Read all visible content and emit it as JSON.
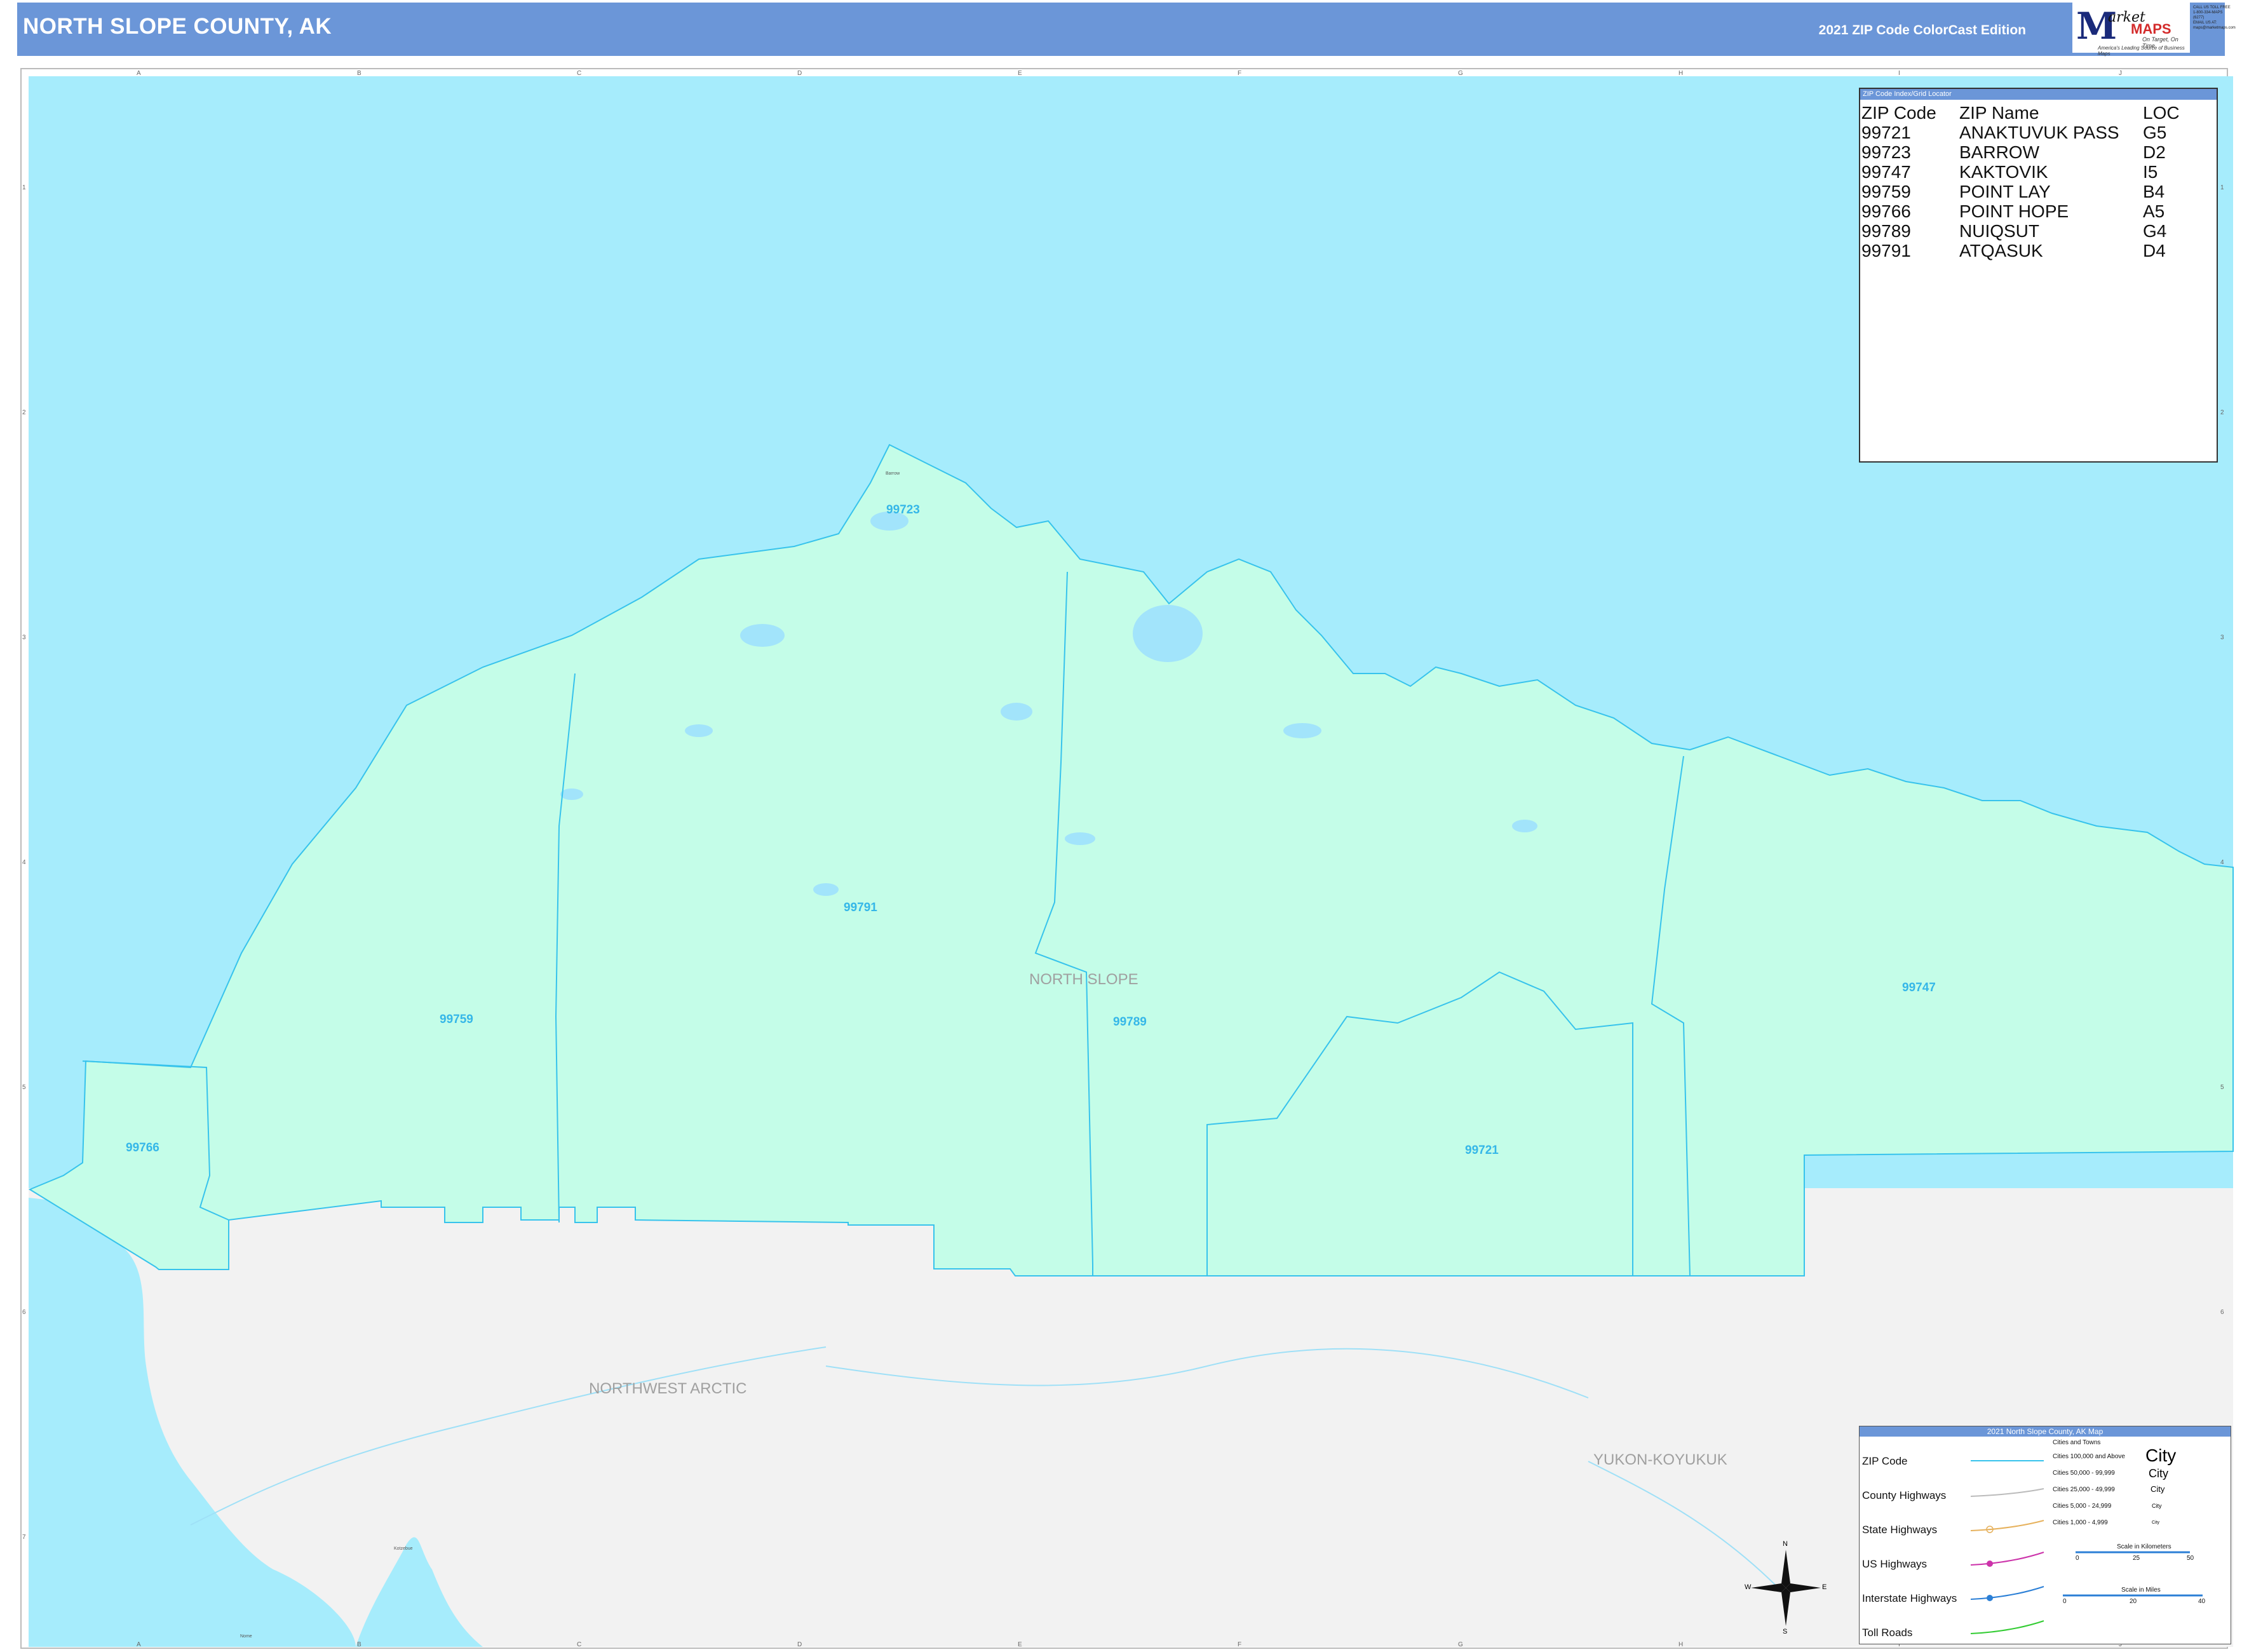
{
  "header": {
    "title": "NORTH SLOPE COUNTY, AK",
    "edition": "2021 ZIP Code ColorCast Edition",
    "logo": {
      "m": "M",
      "arket": "arket",
      "maps": "MAPS",
      "tagline": "On Target, On Time",
      "subtitle": "America's Leading Source of Business Maps"
    },
    "contact": [
      "CALL US TOLL FREE",
      "1-800-334-MAPS (6277)",
      "EMAIL US AT:",
      "maps@marketmaps.com"
    ]
  },
  "grid": {
    "columns": [
      "A",
      "B",
      "C",
      "D",
      "E",
      "F",
      "G",
      "H",
      "I",
      "J"
    ],
    "rows": [
      "1",
      "2",
      "3",
      "4",
      "5",
      "6",
      "7"
    ]
  },
  "map": {
    "region_labels": {
      "north_slope": "NORTH SLOPE",
      "northwest_arctic": "NORTHWEST ARCTIC",
      "yukon_koyukuk": "YUKON-KOYUKUK"
    },
    "zip_labels": [
      "99723",
      "99791",
      "99759",
      "99789",
      "99747",
      "99766",
      "99721"
    ],
    "town_labels": [
      "Barrow",
      "Kotzebue",
      "Nome"
    ],
    "colors": {
      "ocean": "#a6ecfc",
      "zip_fill": "#c4fde8",
      "outside": "#f2f2f2",
      "boundary": "#37c3ec",
      "zip_text": "#35b7e8"
    }
  },
  "zip_index": {
    "title": "ZIP Code Index/Grid Locator",
    "columns": [
      "ZIP Code",
      "ZIP Name",
      "LOC"
    ],
    "rows": [
      [
        "99721",
        "ANAKTUVUK PASS",
        "G5"
      ],
      [
        "99723",
        "BARROW",
        "D2"
      ],
      [
        "99747",
        "KAKTOVIK",
        "I5"
      ],
      [
        "99759",
        "POINT LAY",
        "B4"
      ],
      [
        "99766",
        "POINT HOPE",
        "A5"
      ],
      [
        "99789",
        "NUIQSUT",
        "G4"
      ],
      [
        "99791",
        "ATQASUK",
        "D4"
      ]
    ]
  },
  "legend": {
    "title": "2021 North Slope County, AK Map",
    "items": [
      "ZIP Code",
      "County Highways",
      "State Highways",
      "US Highways",
      "Interstate Highways",
      "Toll Roads"
    ],
    "cities_title": "Cities and Towns",
    "city_classes": [
      "Cities 100,000 and Above",
      "Cities 50,000 - 99,999",
      "Cities 25,000 - 49,999",
      "Cities 5,000 - 24,999",
      "Cities 1,000 - 4,999"
    ],
    "city_samples": [
      "City",
      "City",
      "City",
      "City",
      "City"
    ],
    "scale_km": {
      "title": "Scale in Kilometers",
      "ticks": [
        "0",
        "25",
        "50"
      ]
    },
    "scale_miles": {
      "title": "Scale in Miles",
      "ticks": [
        "0",
        "20",
        "40"
      ]
    },
    "compass": {
      "n": "N",
      "s": "S",
      "e": "E",
      "w": "W"
    },
    "line_colors": {
      "zip": "#37c3ec",
      "county": "#bbbbbb",
      "state": "#e6b15c",
      "us": "#cc33aa",
      "interstate": "#2b7fd6",
      "toll": "#33cc33"
    }
  }
}
